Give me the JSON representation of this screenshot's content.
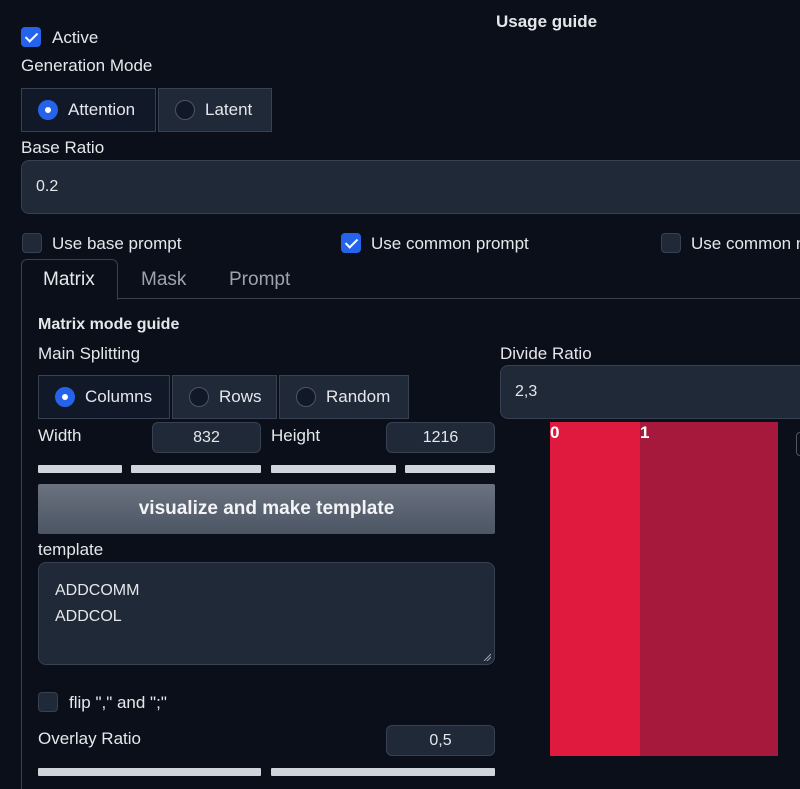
{
  "header": {
    "usage_guide": "Usage guide"
  },
  "active": {
    "label": "Active",
    "checked": true
  },
  "generation_mode": {
    "label": "Generation Mode",
    "options": [
      "Attention",
      "Latent"
    ],
    "selected": "Attention"
  },
  "base_ratio": {
    "label": "Base Ratio",
    "value": "0.2"
  },
  "prompt_options": [
    {
      "label": "Use base prompt",
      "checked": false
    },
    {
      "label": "Use common prompt",
      "checked": true
    },
    {
      "label": "Use common n",
      "checked": false
    }
  ],
  "tabs": [
    "Matrix",
    "Mask",
    "Prompt"
  ],
  "active_tab": "Matrix",
  "matrix": {
    "guide": "Matrix mode guide",
    "main_splitting": {
      "label": "Main Splitting",
      "options": [
        "Columns",
        "Rows",
        "Random"
      ],
      "selected": "Columns"
    },
    "width": {
      "label": "Width",
      "value": "832"
    },
    "height": {
      "label": "Height",
      "value": "1216"
    },
    "visualize_button": "visualize and make template",
    "template": {
      "label": "template",
      "line1": "ADDCOMM",
      "line2": "ADDCOL"
    },
    "flip": {
      "label": "flip \",\" and \";\"",
      "checked": false
    },
    "overlay_ratio": {
      "label": "Overlay Ratio",
      "value": "0,5"
    },
    "divide_ratio": {
      "label": "Divide Ratio",
      "value": "2,3"
    },
    "preview": {
      "region_labels": [
        "0",
        "1"
      ],
      "colors": [
        "#e0193f",
        "#a6183c"
      ]
    }
  }
}
